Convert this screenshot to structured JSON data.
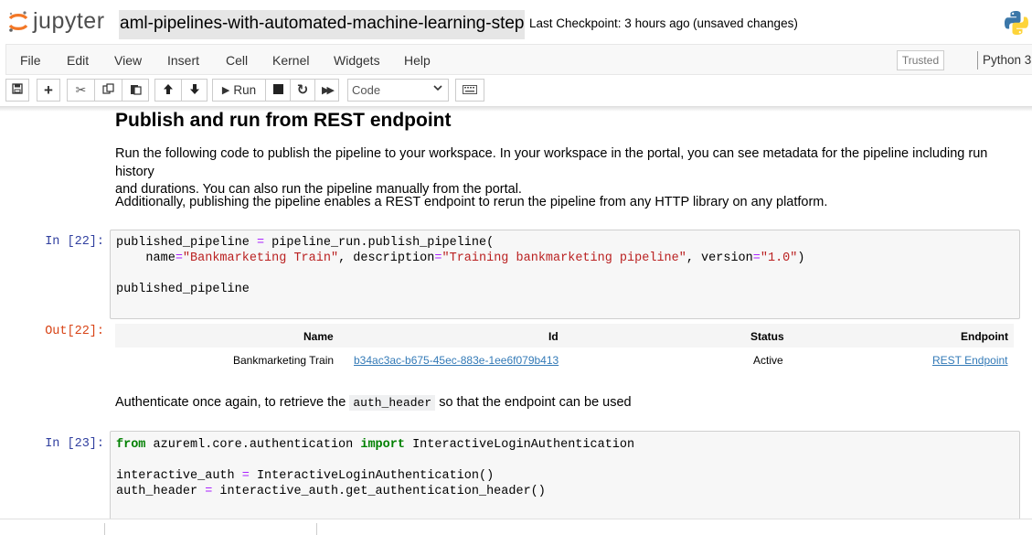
{
  "header": {
    "logo_text": "jupyter",
    "notebook_title": "aml-pipelines-with-automated-machine-learning-step",
    "checkpoint": "Last Checkpoint: 3 hours ago",
    "unsaved": "(unsaved changes)"
  },
  "menubar": {
    "items": [
      "File",
      "Edit",
      "View",
      "Insert",
      "Cell",
      "Kernel",
      "Widgets",
      "Help"
    ],
    "trusted": "Trusted",
    "kernel": "Python 3"
  },
  "toolbar": {
    "run_label": "Run",
    "cell_type": "Code"
  },
  "cells": {
    "md1_heading": "Publish and run from REST endpoint",
    "md1_p1_line1": "Run the following code to publish the pipeline to your workspace. In your workspace in the portal, you can see metadata for the pipeline including run history",
    "md1_p1_line2": "and durations. You can also run the pipeline manually from the portal.",
    "md1_p2": "Additionally, publishing the pipeline enables a REST endpoint to rerun the pipeline from any HTTP library on any platform.",
    "in22_prompt": "In [22]:",
    "out22_prompt": "Out[22]:",
    "in22_code": {
      "line1_a": "published_pipeline ",
      "line1_op": "=",
      "line1_b": " pipeline_run.publish_pipeline(",
      "line2_a": "    name",
      "line2_op1": "=",
      "line2_s1": "\"Bankmarketing Train\"",
      "line2_b": ", description",
      "line2_op2": "=",
      "line2_s2": "\"Training bankmarketing pipeline\"",
      "line2_c": ", version",
      "line2_op3": "=",
      "line2_s3": "\"1.0\"",
      "line2_d": ")",
      "line4": "published_pipeline"
    },
    "out22_table": {
      "headers": [
        "Name",
        "Id",
        "Status",
        "Endpoint"
      ],
      "row": [
        "Bankmarketing Train",
        "b34ac3ac-b675-45ec-883e-1ee6f079b413",
        "Active",
        "REST Endpoint"
      ]
    },
    "md2_before": "Authenticate once again, to retrieve the ",
    "md2_code": "auth_header",
    "md2_after": " so that the endpoint can be used",
    "in23_prompt": "In [23]:",
    "in23_code": {
      "l1_kw1": "from",
      "l1_mod": " azureml.core.authentication ",
      "l1_kw2": "import",
      "l1_cls": " InteractiveLoginAuthentication",
      "l3_a": "interactive_auth ",
      "l3_op": "=",
      "l3_b": " InteractiveLoginAuthentication()",
      "l4_a": "auth_header ",
      "l4_op": "=",
      "l4_b": " interactive_auth.get_authentication_header()"
    }
  },
  "colors": {
    "prompt_in": "#303F9F",
    "prompt_out": "#D84315",
    "keyword": "#008000",
    "string": "#BA2121",
    "operator": "#AA22FF",
    "link": "#337ab7"
  }
}
